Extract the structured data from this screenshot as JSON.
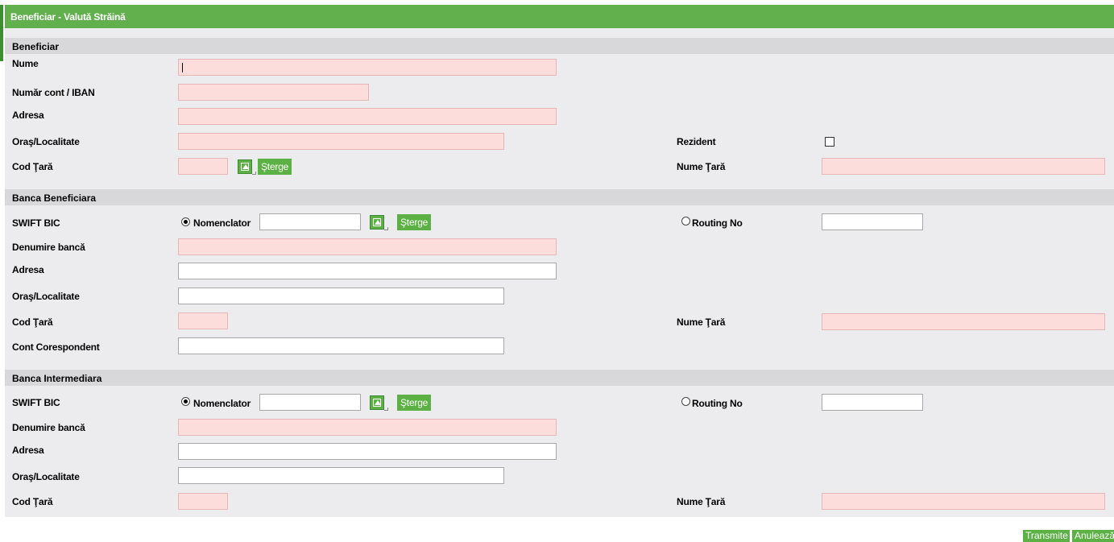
{
  "title": "Beneficiar - Valută Străină",
  "colors": {
    "header": "#62b04d",
    "section": "#d8d8da",
    "required_field": "#fddcdc",
    "button": "#5bb143"
  },
  "icons": {
    "lookup": "lookup-arrow-icon"
  },
  "beneficiar": {
    "heading": "Beneficiar",
    "nume_label": "Nume",
    "nume_value": "",
    "iban_label": "Număr cont / IBAN",
    "iban_value": "",
    "adresa_label": "Adresa",
    "adresa_value": "",
    "oras_label": "Oraş/Localitate",
    "oras_value": "",
    "rezident_label": "Rezident",
    "rezident_checked": false,
    "cod_tara_label": "Cod Ţară",
    "cod_tara_value": "",
    "sterge_label": "Şterge",
    "nume_tara_label": "Nume Ţară",
    "nume_tara_value": ""
  },
  "banca_beneficiara": {
    "heading": "Banca Beneficiara",
    "swift_label": "SWIFT BIC",
    "nomenclator_label": "Nomenclator",
    "nomenclator_selected": true,
    "nomenclator_value": "",
    "sterge_label": "Şterge",
    "routing_label": "Routing No",
    "routing_value": "",
    "denumire_label": "Denumire bancă",
    "denumire_value": "",
    "adresa_label": "Adresa",
    "adresa_value": "",
    "oras_label": "Oraş/Localitate",
    "oras_value": "",
    "cod_tara_label": "Cod Ţară",
    "cod_tara_value": "",
    "nume_tara_label": "Nume Ţară",
    "nume_tara_value": "",
    "cont_label": "Cont Corespondent",
    "cont_value": ""
  },
  "banca_intermediara": {
    "heading": "Banca Intermediara",
    "swift_label": "SWIFT BIC",
    "nomenclator_label": "Nomenclator",
    "nomenclator_selected": true,
    "nomenclator_value": "",
    "sterge_label": "Şterge",
    "routing_label": "Routing No",
    "routing_value": "",
    "denumire_label": "Denumire bancă",
    "denumire_value": "",
    "adresa_label": "Adresa",
    "adresa_value": "",
    "oras_label": "Oraş/Localitate",
    "oras_value": "",
    "cod_tara_label": "Cod Ţară",
    "cod_tara_value": "",
    "nume_tara_label": "Nume Ţară",
    "nume_tara_value": ""
  },
  "actions": {
    "transmite_label": "Transmite",
    "anuleaza_label": "Anulează"
  }
}
